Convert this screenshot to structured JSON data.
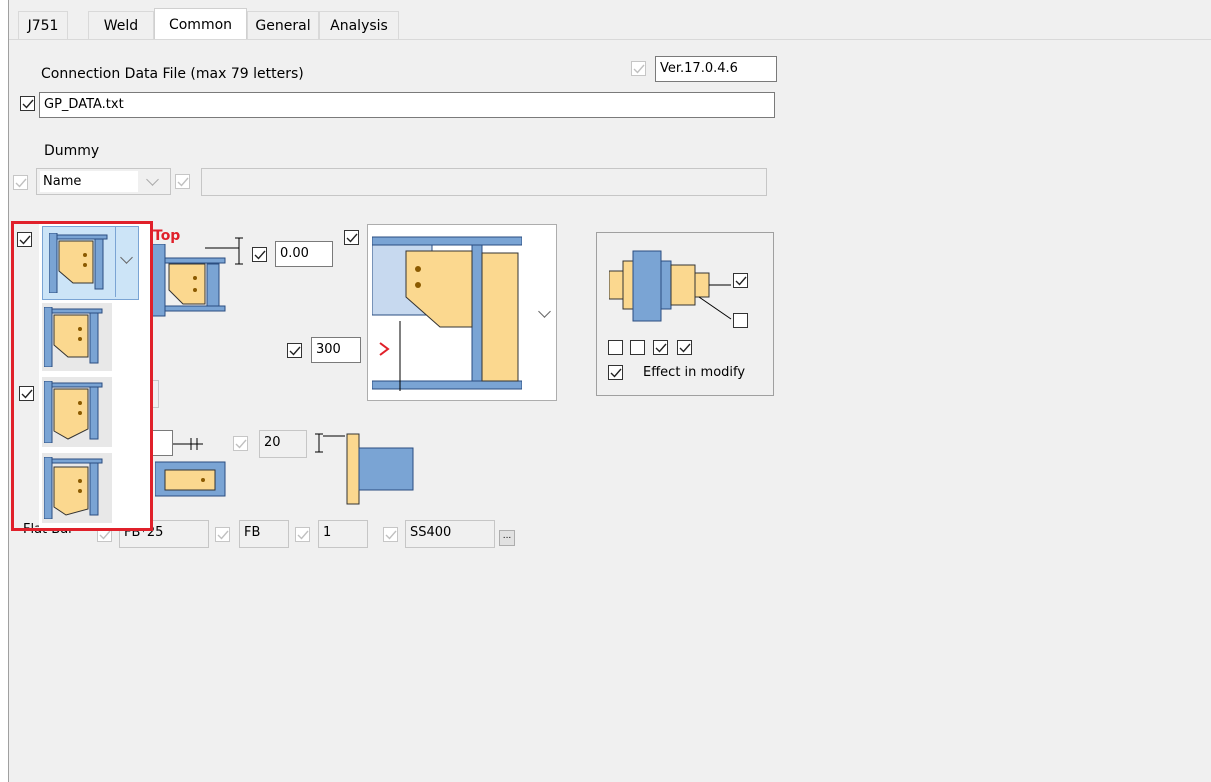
{
  "tabs": [
    "J751",
    "Weld",
    "Common",
    "General",
    "Analysis"
  ],
  "active_tab": "Common",
  "version": "Ver.17.0.4.6",
  "connection_file": {
    "label": "Connection Data File (max 79 letters)",
    "value": "GP_DATA.txt"
  },
  "dummy": {
    "label": "Dummy",
    "select_value": "Name",
    "text_value": ""
  },
  "top_label": "Top",
  "offset_value": "0.00",
  "length_value": "300",
  "effect_label": "Effect in modify",
  "spacing_value": "20",
  "flat_bar": {
    "label": "Flat Bar",
    "size": "FB*25",
    "type": "FB",
    "count": "1",
    "material": "SS400",
    "browse_label": "..."
  },
  "colors": {
    "accent_red": "#e0202a",
    "plate_yellow": "#fbd88f",
    "steel_blue": "#7aa4d4",
    "selection_blue": "#cce4f7"
  },
  "icons": [
    "check-icon",
    "chevron-down-icon",
    "connection-type-icon",
    "dimension-arrow-icon"
  ]
}
